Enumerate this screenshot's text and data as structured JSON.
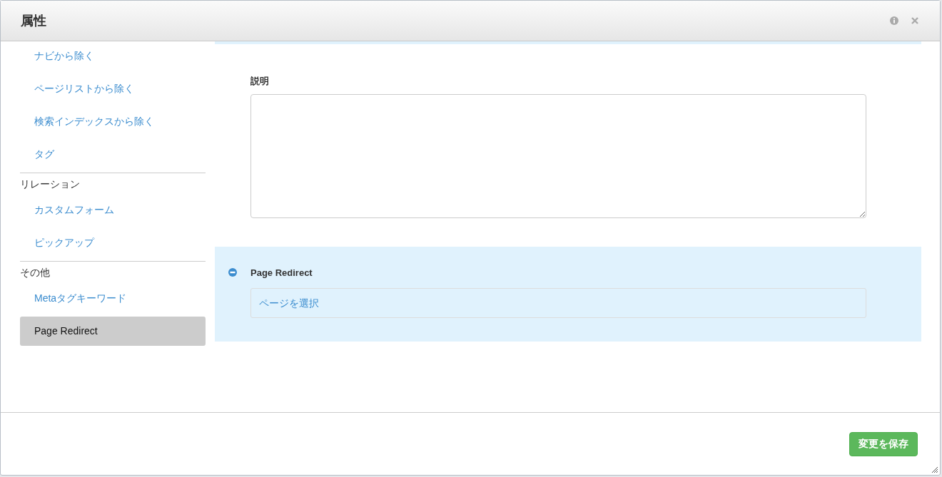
{
  "dialog": {
    "title": "属性"
  },
  "sidebar": {
    "groups": [
      {
        "items": [
          {
            "label": "ナビから除く",
            "selected": false
          },
          {
            "label": "ページリストから除く",
            "selected": false
          },
          {
            "label": "検索インデックスから除く",
            "selected": false
          },
          {
            "label": "タグ",
            "selected": false
          }
        ]
      },
      {
        "heading": "リレーション",
        "items": [
          {
            "label": "カスタムフォーム",
            "selected": false
          },
          {
            "label": "ピックアップ",
            "selected": false
          }
        ]
      },
      {
        "heading": "その他",
        "items": [
          {
            "label": "Metaタグキーワード",
            "selected": false
          },
          {
            "label": "Page Redirect",
            "selected": true
          }
        ]
      }
    ]
  },
  "description": {
    "label": "説明"
  },
  "page_redirect": {
    "title": "Page Redirect",
    "expanded": true,
    "selector": "ページを選択"
  },
  "footer": {
    "save_button": "変更を保存"
  }
}
